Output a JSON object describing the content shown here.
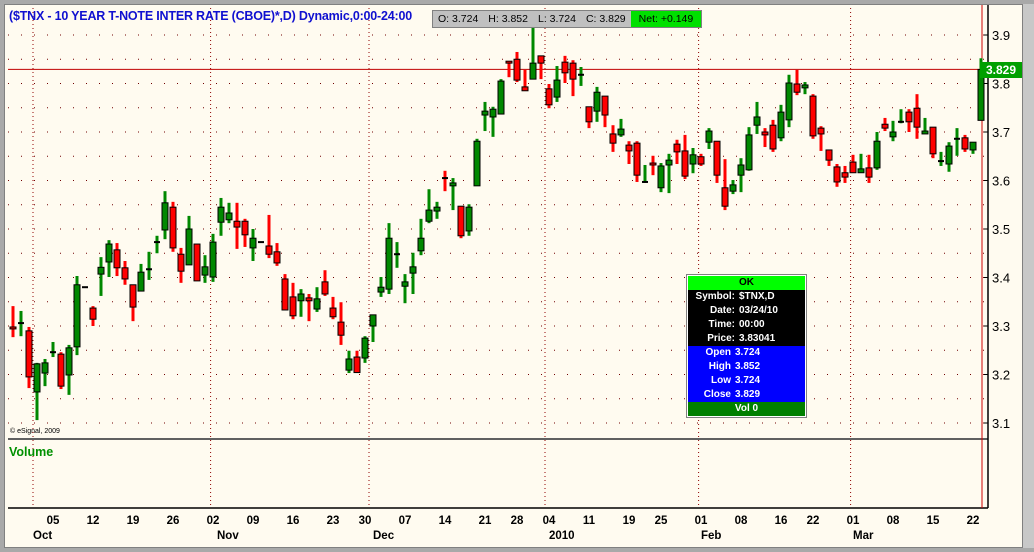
{
  "title": "($TNX - 10 YEAR T-NOTE INTER RATE (CBOE)*,D) Dynamic,0:00-24:00",
  "quote_bar": {
    "open": "O: 3.724",
    "high": "H: 3.852",
    "low": "L: 3.724",
    "close": "C: 3.829",
    "net": "Net: +0.149"
  },
  "copyright": "© eSignal, 2009",
  "volume_label": "Volume",
  "last_price_label": "3.829",
  "tooltip": {
    "ok": "OK",
    "rows": [
      {
        "k": "Symbol:",
        "v": "$TNX,D"
      },
      {
        "k": "Date:",
        "v": "03/24/10"
      },
      {
        "k": "Time:",
        "v": "00:00"
      },
      {
        "k": "Price:",
        "v": "3.83041"
      }
    ],
    "ohlc": [
      {
        "k": "Open",
        "v": "3.724"
      },
      {
        "k": "High",
        "v": "3.852"
      },
      {
        "k": "Low",
        "v": "3.724"
      },
      {
        "k": "Close",
        "v": "3.829"
      }
    ],
    "vol": "Vol 0"
  },
  "colors": {
    "up": "#008800",
    "down": "#ff0000",
    "accent": "#1010d0",
    "net": "#00e000"
  },
  "chart_data": {
    "type": "candlestick",
    "symbol": "$TNX",
    "ylim": [
      3.08,
      3.93
    ],
    "yticks": [
      3.1,
      3.2,
      3.3,
      3.4,
      3.5,
      3.6,
      3.7,
      3.8,
      3.9
    ],
    "ytick_labels": [
      "3.1",
      "3.2",
      "3.3",
      "3.4",
      "3.5",
      "3.6",
      "3.7",
      "3.8",
      "3.9"
    ],
    "last_close": 3.829,
    "x_day_labels": [
      {
        "i": 5,
        "t": "05"
      },
      {
        "i": 10,
        "t": "12"
      },
      {
        "i": 15,
        "t": "19"
      },
      {
        "i": 20,
        "t": "26"
      },
      {
        "i": 25,
        "t": "02"
      },
      {
        "i": 30,
        "t": "09"
      },
      {
        "i": 35,
        "t": "16"
      },
      {
        "i": 40,
        "t": "23"
      },
      {
        "i": 44,
        "t": "30"
      },
      {
        "i": 49,
        "t": "07"
      },
      {
        "i": 54,
        "t": "14"
      },
      {
        "i": 59,
        "t": "21"
      },
      {
        "i": 63,
        "t": "28"
      },
      {
        "i": 67,
        "t": "04"
      },
      {
        "i": 72,
        "t": "11"
      },
      {
        "i": 77,
        "t": "19"
      },
      {
        "i": 81,
        "t": "25"
      },
      {
        "i": 86,
        "t": "01"
      },
      {
        "i": 91,
        "t": "08"
      },
      {
        "i": 96,
        "t": "16"
      },
      {
        "i": 100,
        "t": "22"
      },
      {
        "i": 105,
        "t": "01"
      },
      {
        "i": 110,
        "t": "08"
      },
      {
        "i": 115,
        "t": "15"
      },
      {
        "i": 120,
        "t": "22"
      }
    ],
    "x_month_labels": [
      {
        "i": 2,
        "t": "Oct"
      },
      {
        "i": 25,
        "t": "Nov"
      },
      {
        "i": 44.5,
        "t": "Dec"
      },
      {
        "i": 66.5,
        "t": "2010"
      },
      {
        "i": 85.5,
        "t": "Feb"
      },
      {
        "i": 104.5,
        "t": "Mar"
      }
    ],
    "month_separators": [
      2,
      24.2,
      44,
      66,
      85.2,
      104.2
    ],
    "ohlc": [
      [
        3.298,
        3.341,
        3.277,
        3.294
      ],
      [
        3.306,
        3.331,
        3.279,
        3.306
      ],
      [
        3.29,
        3.298,
        3.172,
        3.195
      ],
      [
        3.164,
        3.224,
        3.106,
        3.222
      ],
      [
        3.203,
        3.232,
        3.176,
        3.224
      ],
      [
        3.246,
        3.267,
        3.236,
        3.246
      ],
      [
        3.242,
        3.246,
        3.17,
        3.176
      ],
      [
        3.199,
        3.261,
        3.158,
        3.255
      ],
      [
        3.257,
        3.403,
        3.24,
        3.385
      ],
      [
        3.38,
        3.381,
        3.379,
        3.38
      ],
      [
        3.337,
        3.341,
        3.3,
        3.314
      ],
      [
        3.407,
        3.442,
        3.362,
        3.421
      ],
      [
        3.432,
        3.477,
        3.401,
        3.469
      ],
      [
        3.457,
        3.471,
        3.403,
        3.42
      ],
      [
        3.42,
        3.434,
        3.385,
        3.397
      ],
      [
        3.385,
        3.385,
        3.31,
        3.339
      ],
      [
        3.372,
        3.428,
        3.372,
        3.411
      ],
      [
        3.417,
        3.453,
        3.395,
        3.417
      ],
      [
        3.473,
        3.486,
        3.45,
        3.473
      ],
      [
        3.498,
        3.578,
        3.479,
        3.554
      ],
      [
        3.545,
        3.556,
        3.453,
        3.461
      ],
      [
        3.448,
        3.461,
        3.389,
        3.413
      ],
      [
        3.426,
        3.527,
        3.426,
        3.5
      ],
      [
        3.469,
        3.469,
        3.393,
        3.393
      ],
      [
        3.405,
        3.446,
        3.389,
        3.422
      ],
      [
        3.401,
        3.49,
        3.391,
        3.473
      ],
      [
        3.514,
        3.564,
        3.486,
        3.545
      ],
      [
        3.519,
        3.554,
        3.512,
        3.533
      ],
      [
        3.516,
        3.554,
        3.459,
        3.504
      ],
      [
        3.516,
        3.521,
        3.463,
        3.488
      ],
      [
        3.461,
        3.5,
        3.434,
        3.481
      ],
      [
        3.473,
        3.474,
        3.472,
        3.473
      ],
      [
        3.465,
        3.529,
        3.44,
        3.448
      ],
      [
        3.453,
        3.471,
        3.424,
        3.43
      ],
      [
        3.397,
        3.407,
        3.333,
        3.333
      ],
      [
        3.36,
        3.389,
        3.314,
        3.321
      ],
      [
        3.352,
        3.376,
        3.319,
        3.366
      ],
      [
        3.358,
        3.366,
        3.31,
        3.352
      ],
      [
        3.335,
        3.38,
        3.329,
        3.356
      ],
      [
        3.391,
        3.415,
        3.362,
        3.366
      ],
      [
        3.337,
        3.36,
        3.314,
        3.319
      ],
      [
        3.308,
        3.349,
        3.261,
        3.281
      ],
      [
        3.209,
        3.249,
        3.203,
        3.232
      ],
      [
        3.236,
        3.249,
        3.204,
        3.204
      ],
      [
        3.234,
        3.279,
        3.224,
        3.275
      ],
      [
        3.3,
        3.323,
        3.267,
        3.323
      ],
      [
        3.37,
        3.401,
        3.36,
        3.38
      ],
      [
        3.376,
        3.512,
        3.366,
        3.481
      ],
      [
        3.448,
        3.473,
        3.42,
        3.448
      ],
      [
        3.382,
        3.407,
        3.347,
        3.391
      ],
      [
        3.409,
        3.451,
        3.366,
        3.422
      ],
      [
        3.455,
        3.521,
        3.446,
        3.481
      ],
      [
        3.516,
        3.582,
        3.512,
        3.539
      ],
      [
        3.537,
        3.556,
        3.521,
        3.545
      ],
      [
        3.605,
        3.62,
        3.578,
        3.603
      ],
      [
        3.589,
        3.605,
        3.539,
        3.595
      ],
      [
        3.547,
        3.547,
        3.481,
        3.486
      ],
      [
        3.496,
        3.551,
        3.486,
        3.545
      ],
      [
        3.589,
        3.686,
        3.589,
        3.681
      ],
      [
        3.735,
        3.762,
        3.702,
        3.743
      ],
      [
        3.731,
        3.752,
        3.69,
        3.747
      ],
      [
        3.737,
        3.809,
        3.737,
        3.805
      ],
      [
        3.846,
        3.846,
        3.813,
        3.842
      ],
      [
        3.85,
        3.865,
        3.803,
        3.807
      ],
      [
        3.793,
        3.828,
        3.785,
        3.785
      ],
      [
        3.809,
        3.916,
        3.809,
        3.842
      ],
      [
        3.857,
        3.857,
        3.809,
        3.842
      ],
      [
        3.789,
        3.799,
        3.749,
        3.756
      ],
      [
        3.772,
        3.836,
        3.762,
        3.807
      ],
      [
        3.844,
        3.857,
        3.801,
        3.822
      ],
      [
        3.842,
        3.848,
        3.774,
        3.809
      ],
      [
        3.818,
        3.834,
        3.795,
        3.818
      ],
      [
        3.752,
        3.752,
        3.708,
        3.721
      ],
      [
        3.743,
        3.793,
        3.721,
        3.782
      ],
      [
        3.774,
        3.774,
        3.71,
        3.735
      ],
      [
        3.696,
        3.714,
        3.659,
        3.677
      ],
      [
        3.694,
        3.727,
        3.69,
        3.706
      ],
      [
        3.673,
        3.681,
        3.634,
        3.661
      ],
      [
        3.677,
        3.681,
        3.597,
        3.611
      ],
      [
        3.597,
        3.632,
        3.595,
        3.597
      ],
      [
        3.636,
        3.651,
        3.611,
        3.632
      ],
      [
        3.585,
        3.636,
        3.576,
        3.63
      ],
      [
        3.632,
        3.655,
        3.574,
        3.642
      ],
      [
        3.675,
        3.684,
        3.634,
        3.659
      ],
      [
        3.661,
        3.694,
        3.603,
        3.609
      ],
      [
        3.634,
        3.667,
        3.615,
        3.653
      ],
      [
        3.649,
        3.655,
        3.63,
        3.634
      ],
      [
        3.679,
        3.708,
        3.665,
        3.702
      ],
      [
        3.681,
        3.681,
        3.595,
        3.611
      ],
      [
        3.585,
        3.644,
        3.539,
        3.547
      ],
      [
        3.578,
        3.601,
        3.572,
        3.591
      ],
      [
        3.611,
        3.646,
        3.576,
        3.632
      ],
      [
        3.622,
        3.71,
        3.62,
        3.694
      ],
      [
        3.714,
        3.762,
        3.696,
        3.731
      ],
      [
        3.7,
        3.708,
        3.669,
        3.694
      ],
      [
        3.714,
        3.725,
        3.659,
        3.665
      ],
      [
        3.688,
        3.756,
        3.681,
        3.741
      ],
      [
        3.725,
        3.818,
        3.71,
        3.801
      ],
      [
        3.799,
        3.828,
        3.776,
        3.782
      ],
      [
        3.791,
        3.803,
        3.778,
        3.797
      ],
      [
        3.774,
        3.778,
        3.686,
        3.692
      ],
      [
        3.708,
        3.712,
        3.661,
        3.696
      ],
      [
        3.663,
        3.663,
        3.63,
        3.642
      ],
      [
        3.628,
        3.634,
        3.587,
        3.597
      ],
      [
        3.616,
        3.63,
        3.595,
        3.607
      ],
      [
        3.638,
        3.653,
        3.616,
        3.616
      ],
      [
        3.616,
        3.655,
        3.616,
        3.624
      ],
      [
        3.626,
        3.653,
        3.595,
        3.607
      ],
      [
        3.626,
        3.7,
        3.622,
        3.681
      ],
      [
        3.716,
        3.729,
        3.702,
        3.708
      ],
      [
        3.69,
        3.723,
        3.681,
        3.7
      ],
      [
        3.721,
        3.747,
        3.718,
        3.721
      ],
      [
        3.741,
        3.747,
        3.7,
        3.721
      ],
      [
        3.749,
        3.778,
        3.686,
        3.71
      ],
      [
        3.696,
        3.729,
        3.696,
        3.702
      ],
      [
        3.71,
        3.71,
        3.646,
        3.655
      ],
      [
        3.64,
        3.659,
        3.63,
        3.64
      ],
      [
        3.634,
        3.679,
        3.618,
        3.671
      ],
      [
        3.686,
        3.708,
        3.651,
        3.686
      ],
      [
        3.688,
        3.694,
        3.659,
        3.665
      ],
      [
        3.663,
        3.679,
        3.655,
        3.679
      ],
      [
        3.724,
        3.852,
        3.724,
        3.829
      ]
    ]
  }
}
